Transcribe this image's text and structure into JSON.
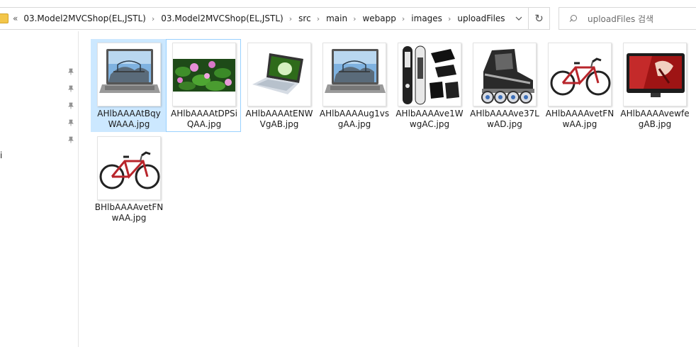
{
  "address_bar": {
    "overflow_icon": "double-chevron-left-icon",
    "breadcrumbs": [
      "03.Model2MVCShop(EL,JSTL)",
      "03.Model2MVCShop(EL,JSTL)",
      "src",
      "main",
      "webapp",
      "images",
      "uploadFiles"
    ],
    "separator": "›",
    "dropdown_icon": "chevron-down-icon",
    "refresh_icon": "refresh-icon",
    "refresh_glyph": "↻"
  },
  "search": {
    "placeholder": "uploadFiles 검색",
    "icon": "search-icon"
  },
  "nav_pane": {
    "pin_count": 5,
    "pin_icon": "pin-icon",
    "partial_label": "i"
  },
  "files": [
    {
      "name_line1": "AHlbAAAAtBqy",
      "name_line2": "WAAA.jpg",
      "thumb": "laptop",
      "selected": true,
      "focused": false
    },
    {
      "name_line1": "AHlbAAAAtDPSi",
      "name_line2": "QAA.jpg",
      "thumb": "lotus",
      "selected": false,
      "focused": true
    },
    {
      "name_line1": "AHlbAAAAtENW",
      "name_line2": "VgAB.jpg",
      "thumb": "notebook-white",
      "selected": false,
      "focused": false
    },
    {
      "name_line1": "AHlbAAAAug1vs",
      "name_line2": "gAA.jpg",
      "thumb": "laptop",
      "selected": false,
      "focused": false
    },
    {
      "name_line1": "AHlbAAAAve1W",
      "name_line2": "wgAC.jpg",
      "thumb": "snowboard",
      "selected": false,
      "focused": false
    },
    {
      "name_line1": "AHlbAAAAve37L",
      "name_line2": "wAD.jpg",
      "thumb": "inline-skate",
      "selected": false,
      "focused": false
    },
    {
      "name_line1": "AHlbAAAAvetFN",
      "name_line2": "wAA.jpg",
      "thumb": "bicycle",
      "selected": false,
      "focused": false
    },
    {
      "name_line1": "AHlbAAAAvewfe",
      "name_line2": "gAB.jpg",
      "thumb": "tv",
      "selected": false,
      "focused": false
    },
    {
      "name_line1": "BHlbAAAAvetFN",
      "name_line2": "wAA.jpg",
      "thumb": "bicycle",
      "selected": false,
      "focused": false
    }
  ],
  "colors": {
    "selection": "#cce8ff",
    "focus_border": "#99d1ff",
    "folder": "#f3c64a"
  }
}
